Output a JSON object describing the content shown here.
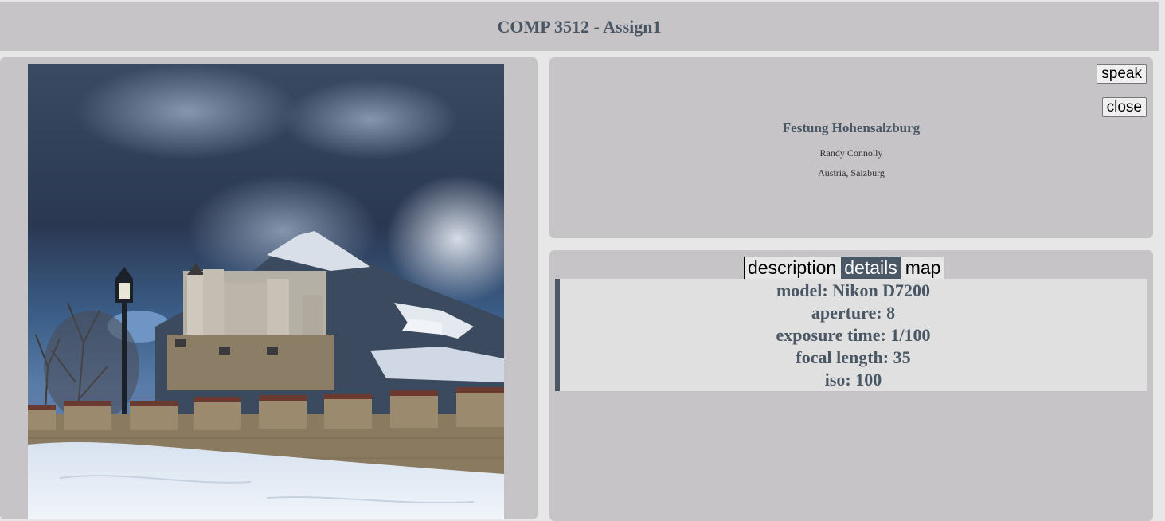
{
  "header": {
    "title": "COMP 3512 - Assign1"
  },
  "photo": {
    "alt": "Festung Hohensalzburg"
  },
  "info": {
    "title": "Festung Hohensalzburg",
    "author": "Randy Connolly",
    "location": "Austria, Salzburg",
    "speak_label": "speak",
    "close_label": "close"
  },
  "tabs": [
    {
      "label": "description",
      "active": false
    },
    {
      "label": "details",
      "active": true
    },
    {
      "label": "map",
      "active": false
    }
  ],
  "details": [
    "model: Nikon D7200",
    "aperture: 8",
    "exposure time: 1/100",
    "focal length: 35",
    "iso: 100"
  ],
  "colors": {
    "accent": "#4a5764",
    "panel": "#c6c4c7",
    "background": "#e7e7e8"
  }
}
